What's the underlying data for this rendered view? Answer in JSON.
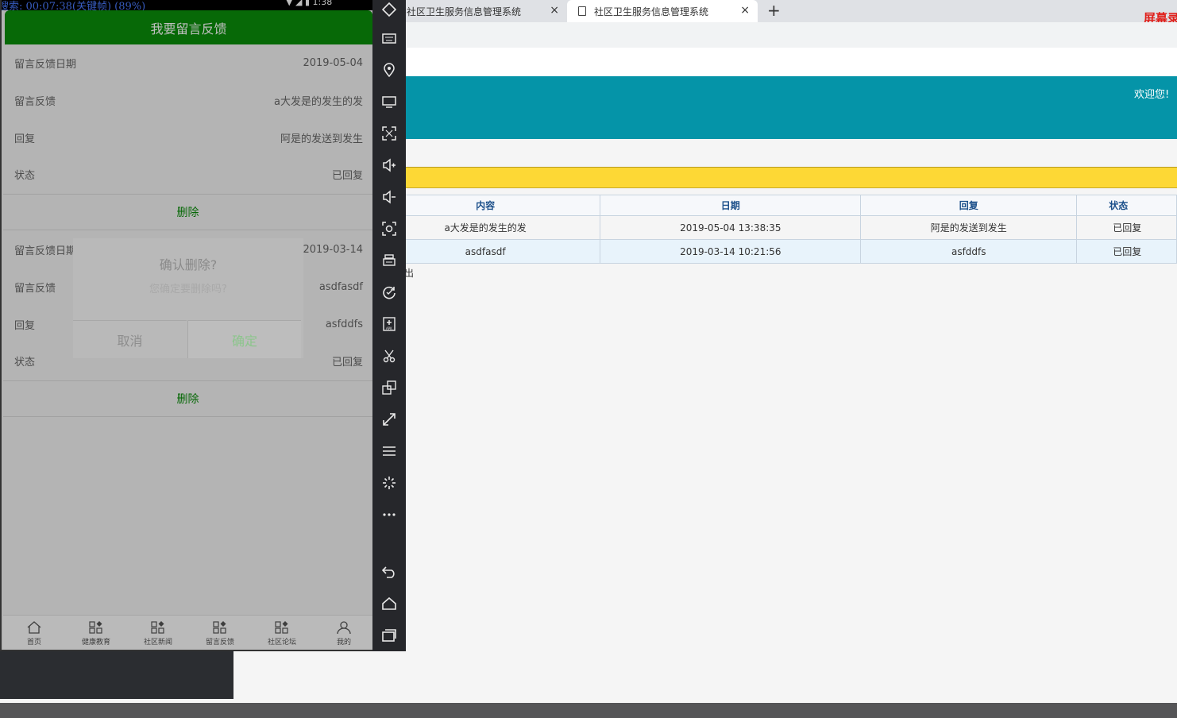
{
  "browser": {
    "tabs": [
      {
        "label": "社区卫生服务信息管理系统",
        "close": "×"
      },
      {
        "label": "社区卫生服务信息管理系统",
        "close": "×"
      }
    ],
    "new_tab": "+",
    "screen_record_label": "屏幕录",
    "welcome": "欢迎您!",
    "table": {
      "headers": [
        "内容",
        "日期",
        "回复",
        "状态"
      ],
      "rows": [
        [
          "a大发是的发生的发",
          "2019-05-04 13:38:35",
          "阿是的发送到发生",
          "已回复"
        ],
        [
          "asdfasdf",
          "2019-03-14 10:21:56",
          "asfddfs",
          "已回复"
        ]
      ]
    },
    "stray_char": "出"
  },
  "phone": {
    "status_text": "搜索: 00:07:38(关键帧) (89%)",
    "status_time": "1:38",
    "header_title": "我要留言反馈",
    "records": [
      {
        "date_label": "留言反馈日期",
        "date_value": "2019-05-04",
        "content_label": "留言反馈",
        "content_value": "a大发是的发生的发",
        "reply_label": "回复",
        "reply_value": "阿是的发送到发生",
        "status_label": "状态",
        "status_value": "已回复",
        "delete_label": "删除"
      },
      {
        "date_label": "留言反馈日期",
        "date_value": "2019-03-14",
        "content_label": "留言反馈",
        "content_value": "asdfasdf",
        "reply_label": "回复",
        "reply_value": "asfddfs",
        "status_label": "状态",
        "status_value": "已回复",
        "delete_label": "删除"
      }
    ],
    "dialog": {
      "title": "确认删除?",
      "message": "您确定要删除吗?",
      "cancel": "取消",
      "confirm": "确定"
    },
    "nav": [
      {
        "label": "首页",
        "icon": "home-icon"
      },
      {
        "label": "健康教育",
        "icon": "grid-icon"
      },
      {
        "label": "社区新闻",
        "icon": "grid-icon"
      },
      {
        "label": "留言反馈",
        "icon": "grid-icon"
      },
      {
        "label": "社区论坛",
        "icon": "grid-icon"
      },
      {
        "label": "我的",
        "icon": "user-icon"
      }
    ]
  },
  "colors": {
    "app_green": "#0a8c0a",
    "teal_header": "#0594a8",
    "yellow_bar": "#fdd835"
  }
}
